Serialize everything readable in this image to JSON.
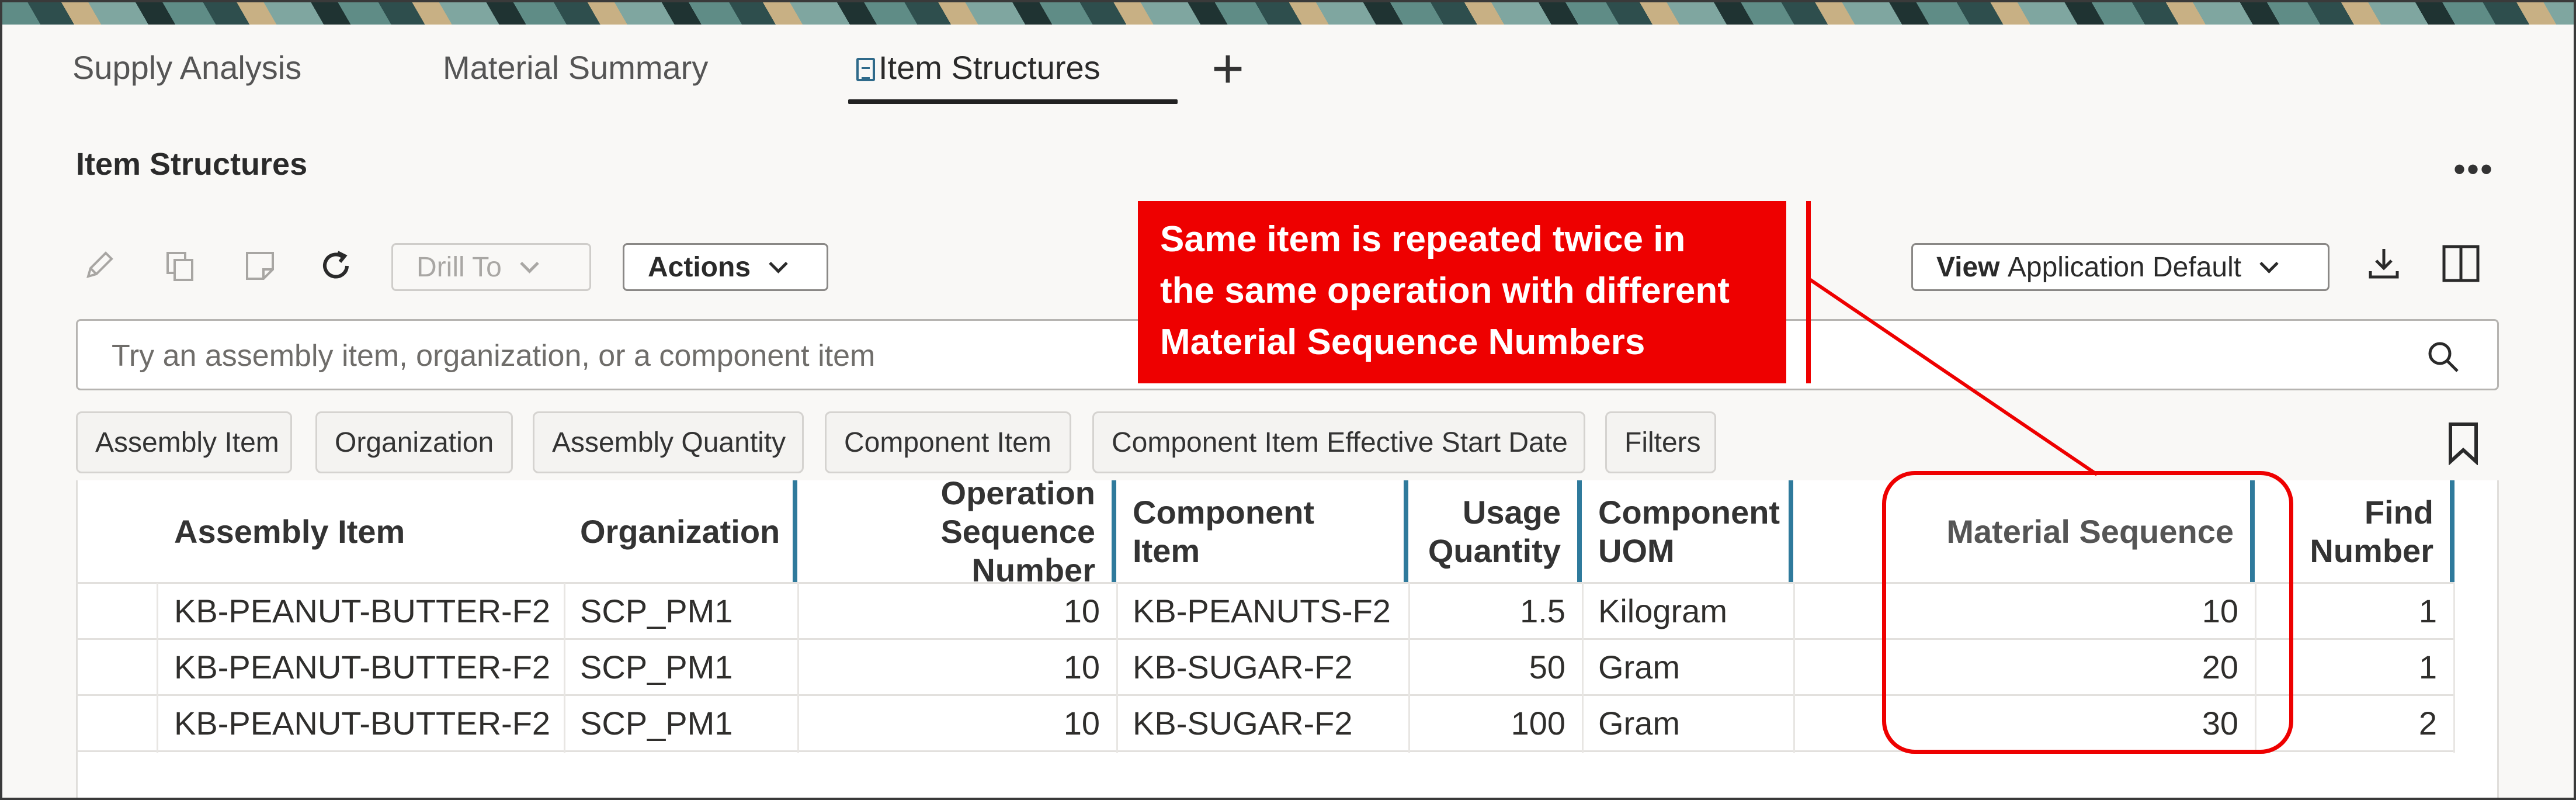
{
  "tabs": [
    {
      "label": "Supply Analysis"
    },
    {
      "label": "Material Summary"
    },
    {
      "label": "Item Structures",
      "active": true
    }
  ],
  "page": {
    "title": "Item Structures"
  },
  "toolbar": {
    "drill_to": "Drill To",
    "actions": "Actions",
    "view_prefix": "View",
    "view_value": "Application Default"
  },
  "search": {
    "placeholder": "Try an assembly item, organization, or a component item"
  },
  "filters": [
    "Assembly Item",
    "Organization",
    "Assembly Quantity",
    "Component Item",
    "Component Item Effective Start Date",
    "Filters"
  ],
  "table": {
    "columns": {
      "assembly_item": "Assembly Item",
      "organization": "Organization",
      "operation_seq_1": "Operation",
      "operation_seq_2": "Sequence Number",
      "component_item": "Component Item",
      "usage_qty_1": "Usage",
      "usage_qty_2": "Quantity",
      "component_uom_1": "Component",
      "component_uom_2": "UOM",
      "material_sequence": "Material Sequence",
      "find_number_1": "Find",
      "find_number_2": "Number"
    },
    "rows": [
      {
        "assembly_item": "KB-PEANUT-BUTTER-F2",
        "organization": "SCP_PM1",
        "operation_seq": "10",
        "component_item": "KB-PEANUTS-F2",
        "usage_qty": "1.5",
        "uom": "Kilogram",
        "material_seq": "10",
        "find_number": "1"
      },
      {
        "assembly_item": "KB-PEANUT-BUTTER-F2",
        "organization": "SCP_PM1",
        "operation_seq": "10",
        "component_item": "KB-SUGAR-F2",
        "usage_qty": "50",
        "uom": "Gram",
        "material_seq": "20",
        "find_number": "1"
      },
      {
        "assembly_item": "KB-PEANUT-BUTTER-F2",
        "organization": "SCP_PM1",
        "operation_seq": "10",
        "component_item": "KB-SUGAR-F2",
        "usage_qty": "100",
        "uom": "Gram",
        "material_seq": "30",
        "find_number": "2"
      }
    ]
  },
  "callout": {
    "text": "Same item is repeated twice in\nthe same operation with different\nMaterial Sequence Numbers"
  },
  "colors": {
    "annotation_red": "#ee0000",
    "frozen_column_marker": "#2f7a9c"
  },
  "icons": [
    "edit-icon",
    "duplicate-icon",
    "note-icon",
    "refresh-icon",
    "chevron-down-icon",
    "download-icon",
    "split-view-icon",
    "search-icon",
    "bookmark-icon",
    "more-icon",
    "plus-icon",
    "document-icon"
  ]
}
